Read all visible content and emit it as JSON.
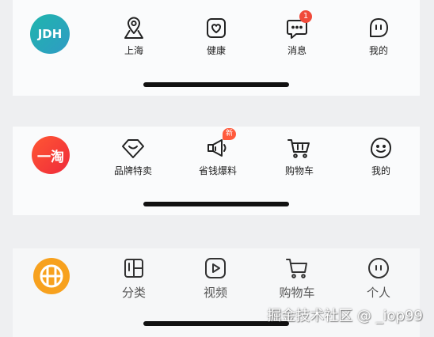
{
  "colors": {
    "jd_logo": "#2aa9b8",
    "taobao_logo": "#f23b2f",
    "tmall_logo": "#f7a11e",
    "badge_red": "#f04a3a",
    "home_indicator": "#111111"
  },
  "jd_bar": {
    "logo_text": "JDH",
    "tabs": [
      {
        "label": "上海",
        "icon": "location-pin-icon"
      },
      {
        "label": "健康",
        "icon": "heart-bag-icon"
      },
      {
        "label": "消息",
        "icon": "chat-bubble-icon",
        "badge": "1"
      },
      {
        "label": "我的",
        "icon": "face-icon"
      }
    ]
  },
  "taobao_bar": {
    "logo_text": "一淘",
    "tabs": [
      {
        "label": "品牌特卖",
        "icon": "heart-diamond-icon"
      },
      {
        "label": "省钱爆料",
        "icon": "megaphone-icon",
        "badge": "新"
      },
      {
        "label": "购物车",
        "icon": "shopping-cart-icon"
      },
      {
        "label": "我的",
        "icon": "smile-face-icon"
      }
    ]
  },
  "tmall_bar": {
    "logo_icon": "grid-ball-logo-icon",
    "tabs": [
      {
        "label": "分类",
        "icon": "category-grid-icon"
      },
      {
        "label": "视频",
        "icon": "video-play-icon"
      },
      {
        "label": "购物车",
        "icon": "shopping-cart-icon"
      },
      {
        "label": "个人",
        "icon": "person-face-icon"
      }
    ]
  },
  "watermark": "掘金技术社区 @ _iop99"
}
